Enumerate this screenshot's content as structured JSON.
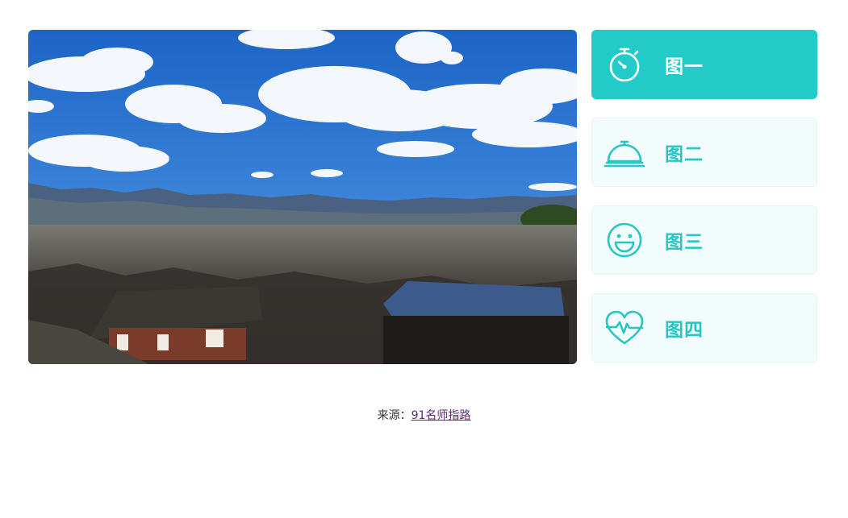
{
  "tabs": [
    {
      "label": "图一",
      "icon": "stopwatch-icon",
      "active": true
    },
    {
      "label": "图二",
      "icon": "service-bell-icon",
      "active": false
    },
    {
      "label": "图三",
      "icon": "smiley-face-icon",
      "active": false
    },
    {
      "label": "图四",
      "icon": "heart-pulse-icon",
      "active": false
    }
  ],
  "footer": {
    "prefix": "来源：",
    "link_text": "91名师指路"
  },
  "colors": {
    "accent": "#22cbc8",
    "inactive_bg": "#f2fcfc",
    "inactive_text": "#27c6c3"
  }
}
